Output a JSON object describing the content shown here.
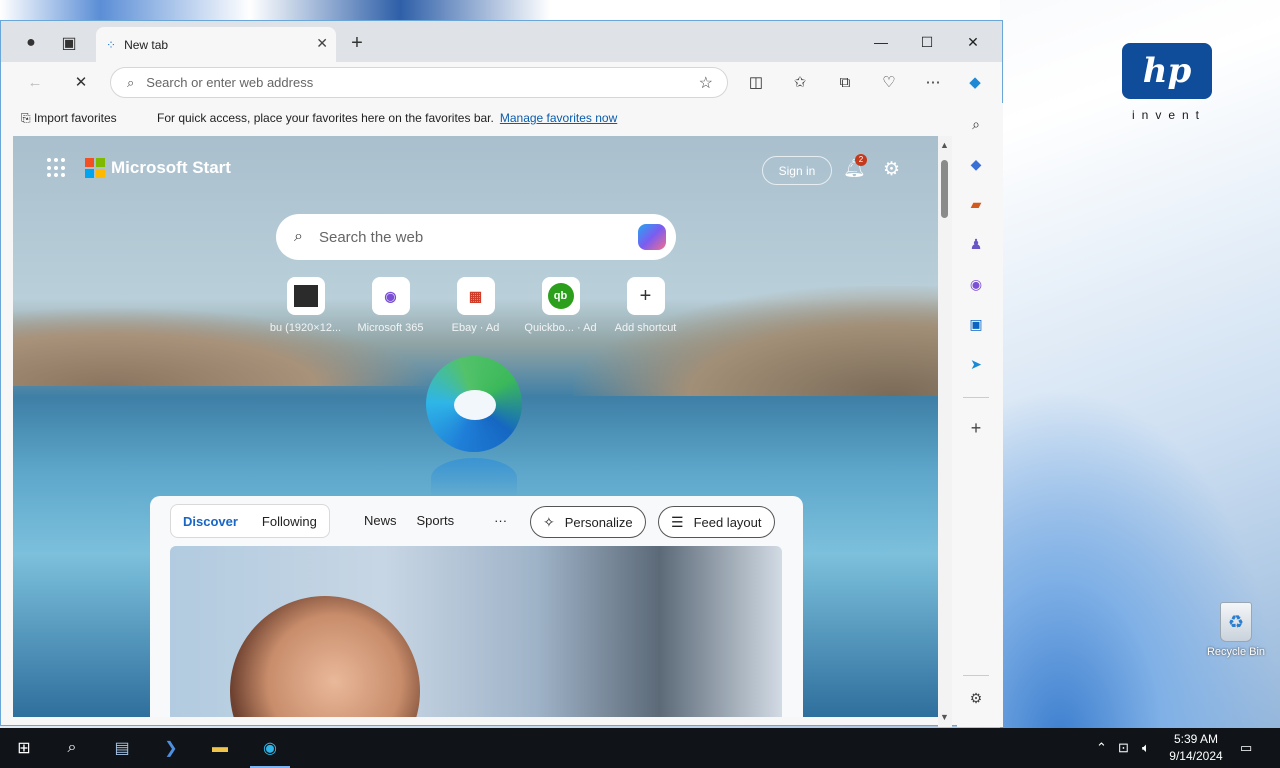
{
  "browser": {
    "tab_title": "New tab",
    "window_controls": {
      "minimize": "—",
      "maximize": "☐",
      "close": "✕"
    },
    "address_placeholder": "Search or enter web address",
    "favbar": {
      "import_label": "Import favorites",
      "message": "For quick access, place your favorites here on the favorites bar.",
      "manage_link": "Manage favorites now"
    }
  },
  "newtab": {
    "brand": "Microsoft Start",
    "sign_in": "Sign in",
    "notification_count": "2",
    "search_placeholder": "Search the web",
    "shortcuts": [
      {
        "label": "bu (1920×12...",
        "icon": "image-icon"
      },
      {
        "label": "Microsoft 365",
        "icon": "m365-icon"
      },
      {
        "label": "Ebay · Ad",
        "icon": "ebay-icon"
      },
      {
        "label": "Quickbo... · Ad",
        "icon": "quickbooks-icon"
      },
      {
        "label": "Add shortcut",
        "icon": "plus-icon"
      }
    ],
    "feed": {
      "tabs": [
        "Discover",
        "Following"
      ],
      "nav": [
        "News",
        "Sports",
        "···"
      ],
      "personalize": "Personalize",
      "feed_layout": "Feed layout"
    }
  },
  "desktop": {
    "brand_mark": "hp",
    "tagline": "invent",
    "recycle_bin": "Recycle Bin"
  },
  "taskbar": {
    "time": "5:39 AM",
    "date": "9/14/2024"
  },
  "colors": {
    "accent": "#1866c6",
    "taskbar": "#101418",
    "badge": "#c43b1c"
  }
}
